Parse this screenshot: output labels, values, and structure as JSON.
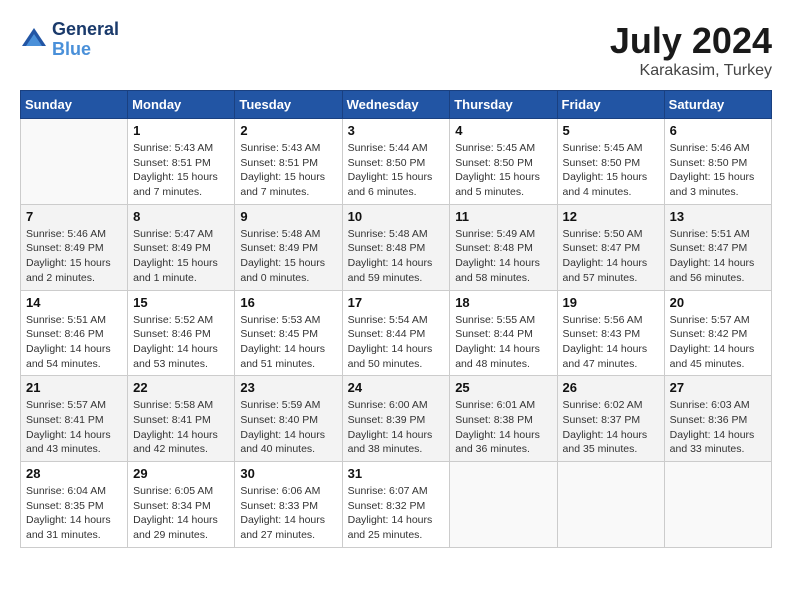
{
  "logo": {
    "text_general": "General",
    "text_blue": "Blue"
  },
  "header": {
    "month": "July 2024",
    "location": "Karakasim, Turkey"
  },
  "weekdays": [
    "Sunday",
    "Monday",
    "Tuesday",
    "Wednesday",
    "Thursday",
    "Friday",
    "Saturday"
  ],
  "weeks": [
    [
      {
        "day": "",
        "info": ""
      },
      {
        "day": "1",
        "info": "Sunrise: 5:43 AM\nSunset: 8:51 PM\nDaylight: 15 hours\nand 7 minutes."
      },
      {
        "day": "2",
        "info": "Sunrise: 5:43 AM\nSunset: 8:51 PM\nDaylight: 15 hours\nand 7 minutes."
      },
      {
        "day": "3",
        "info": "Sunrise: 5:44 AM\nSunset: 8:50 PM\nDaylight: 15 hours\nand 6 minutes."
      },
      {
        "day": "4",
        "info": "Sunrise: 5:45 AM\nSunset: 8:50 PM\nDaylight: 15 hours\nand 5 minutes."
      },
      {
        "day": "5",
        "info": "Sunrise: 5:45 AM\nSunset: 8:50 PM\nDaylight: 15 hours\nand 4 minutes."
      },
      {
        "day": "6",
        "info": "Sunrise: 5:46 AM\nSunset: 8:50 PM\nDaylight: 15 hours\nand 3 minutes."
      }
    ],
    [
      {
        "day": "7",
        "info": "Sunrise: 5:46 AM\nSunset: 8:49 PM\nDaylight: 15 hours\nand 2 minutes."
      },
      {
        "day": "8",
        "info": "Sunrise: 5:47 AM\nSunset: 8:49 PM\nDaylight: 15 hours\nand 1 minute."
      },
      {
        "day": "9",
        "info": "Sunrise: 5:48 AM\nSunset: 8:49 PM\nDaylight: 15 hours\nand 0 minutes."
      },
      {
        "day": "10",
        "info": "Sunrise: 5:48 AM\nSunset: 8:48 PM\nDaylight: 14 hours\nand 59 minutes."
      },
      {
        "day": "11",
        "info": "Sunrise: 5:49 AM\nSunset: 8:48 PM\nDaylight: 14 hours\nand 58 minutes."
      },
      {
        "day": "12",
        "info": "Sunrise: 5:50 AM\nSunset: 8:47 PM\nDaylight: 14 hours\nand 57 minutes."
      },
      {
        "day": "13",
        "info": "Sunrise: 5:51 AM\nSunset: 8:47 PM\nDaylight: 14 hours\nand 56 minutes."
      }
    ],
    [
      {
        "day": "14",
        "info": "Sunrise: 5:51 AM\nSunset: 8:46 PM\nDaylight: 14 hours\nand 54 minutes."
      },
      {
        "day": "15",
        "info": "Sunrise: 5:52 AM\nSunset: 8:46 PM\nDaylight: 14 hours\nand 53 minutes."
      },
      {
        "day": "16",
        "info": "Sunrise: 5:53 AM\nSunset: 8:45 PM\nDaylight: 14 hours\nand 51 minutes."
      },
      {
        "day": "17",
        "info": "Sunrise: 5:54 AM\nSunset: 8:44 PM\nDaylight: 14 hours\nand 50 minutes."
      },
      {
        "day": "18",
        "info": "Sunrise: 5:55 AM\nSunset: 8:44 PM\nDaylight: 14 hours\nand 48 minutes."
      },
      {
        "day": "19",
        "info": "Sunrise: 5:56 AM\nSunset: 8:43 PM\nDaylight: 14 hours\nand 47 minutes."
      },
      {
        "day": "20",
        "info": "Sunrise: 5:57 AM\nSunset: 8:42 PM\nDaylight: 14 hours\nand 45 minutes."
      }
    ],
    [
      {
        "day": "21",
        "info": "Sunrise: 5:57 AM\nSunset: 8:41 PM\nDaylight: 14 hours\nand 43 minutes."
      },
      {
        "day": "22",
        "info": "Sunrise: 5:58 AM\nSunset: 8:41 PM\nDaylight: 14 hours\nand 42 minutes."
      },
      {
        "day": "23",
        "info": "Sunrise: 5:59 AM\nSunset: 8:40 PM\nDaylight: 14 hours\nand 40 minutes."
      },
      {
        "day": "24",
        "info": "Sunrise: 6:00 AM\nSunset: 8:39 PM\nDaylight: 14 hours\nand 38 minutes."
      },
      {
        "day": "25",
        "info": "Sunrise: 6:01 AM\nSunset: 8:38 PM\nDaylight: 14 hours\nand 36 minutes."
      },
      {
        "day": "26",
        "info": "Sunrise: 6:02 AM\nSunset: 8:37 PM\nDaylight: 14 hours\nand 35 minutes."
      },
      {
        "day": "27",
        "info": "Sunrise: 6:03 AM\nSunset: 8:36 PM\nDaylight: 14 hours\nand 33 minutes."
      }
    ],
    [
      {
        "day": "28",
        "info": "Sunrise: 6:04 AM\nSunset: 8:35 PM\nDaylight: 14 hours\nand 31 minutes."
      },
      {
        "day": "29",
        "info": "Sunrise: 6:05 AM\nSunset: 8:34 PM\nDaylight: 14 hours\nand 29 minutes."
      },
      {
        "day": "30",
        "info": "Sunrise: 6:06 AM\nSunset: 8:33 PM\nDaylight: 14 hours\nand 27 minutes."
      },
      {
        "day": "31",
        "info": "Sunrise: 6:07 AM\nSunset: 8:32 PM\nDaylight: 14 hours\nand 25 minutes."
      },
      {
        "day": "",
        "info": ""
      },
      {
        "day": "",
        "info": ""
      },
      {
        "day": "",
        "info": ""
      }
    ]
  ]
}
